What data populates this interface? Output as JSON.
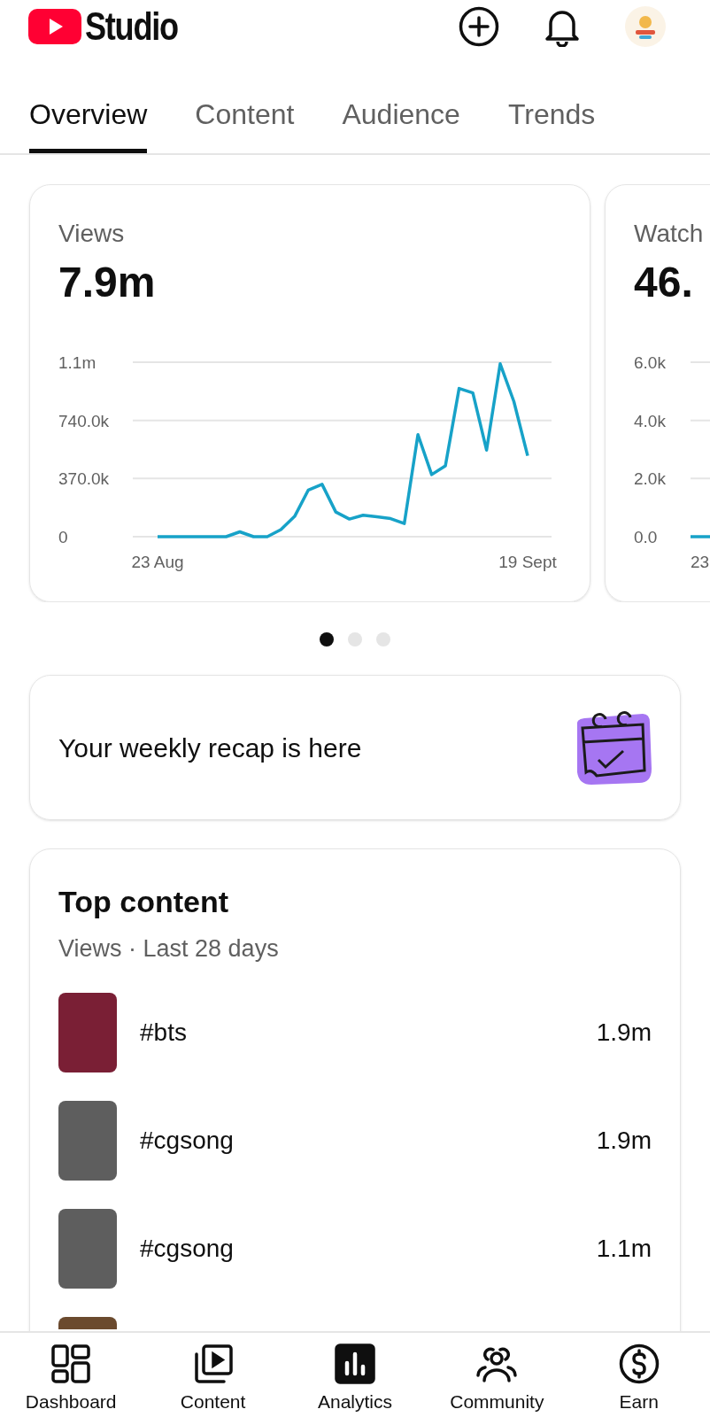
{
  "header": {
    "logo_text": "Studio"
  },
  "tabs": [
    {
      "label": "Overview",
      "selected": true
    },
    {
      "label": "Content",
      "selected": false
    },
    {
      "label": "Audience",
      "selected": false
    },
    {
      "label": "Trends",
      "selected": false
    }
  ],
  "metric_cards": [
    {
      "title": "Views",
      "value": "7.9m",
      "chart_data": {
        "type": "line",
        "categories": [
          "23 Aug",
          null,
          null,
          null,
          null,
          null,
          null,
          null,
          null,
          null,
          null,
          null,
          null,
          null,
          null,
          null,
          null,
          null,
          null,
          null,
          null,
          null,
          null,
          null,
          null,
          null,
          null,
          "19 Sept"
        ],
        "series": [
          {
            "color": "#17a2c8",
            "values": [
              0,
              0,
              0,
              0,
              0,
              0,
              31000,
              0,
              0,
              45000,
              129000,
              297000,
              333000,
              157000,
              112000,
              137000,
              126000,
              115000,
              84000,
              649000,
              395000,
              451000,
              943000,
              915000,
              551000,
              1100000,
              859000,
              515000
            ]
          }
        ],
        "ylim": [
          0,
          1110000
        ],
        "yticks": [
          {
            "value": 0,
            "label": "0"
          },
          {
            "value": 370000,
            "label": "370.0k"
          },
          {
            "value": 740000,
            "label": "740.0k"
          },
          {
            "value": 1110000,
            "label": "1.1m"
          }
        ],
        "grid": true
      }
    },
    {
      "title": "Watch",
      "value": "46.",
      "y_labels": [
        "6.0k",
        "4.0k",
        "2.0k",
        "0.0"
      ],
      "x_label": "23"
    }
  ],
  "pager": [
    {
      "selected": true
    },
    {
      "selected": false
    },
    {
      "selected": false
    }
  ],
  "recap": {
    "text": "Your weekly recap is here"
  },
  "top_content": {
    "title": "Top content",
    "subtitle": "Views · Last 28 days",
    "rows": [
      {
        "title": "#bts",
        "views": "1.9m",
        "color": "#7a1f35"
      },
      {
        "title": "#cgsong",
        "views": "1.9m",
        "color": "#5e5e5e"
      },
      {
        "title": "#cgsong",
        "views": "1.1m",
        "color": "#5e5e5e"
      },
      {
        "color": "#6b4a2e"
      }
    ]
  },
  "bottom_nav": [
    {
      "label": "Dashboard",
      "selected": false
    },
    {
      "label": "Content",
      "selected": false
    },
    {
      "label": "Analytics",
      "selected": true
    },
    {
      "label": "Community",
      "selected": false
    },
    {
      "label": "Earn",
      "selected": false
    }
  ]
}
